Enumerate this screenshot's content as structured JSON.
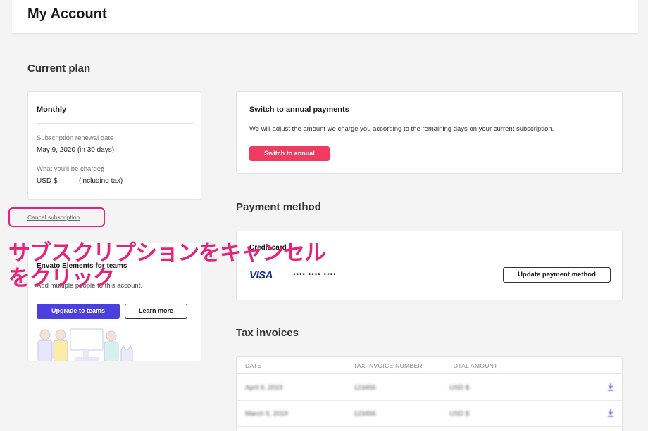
{
  "header": {
    "title": "My Account"
  },
  "current_plan": {
    "section_title": "Current plan",
    "plan_name": "Monthly",
    "renewal_label": "Subscription renewal date",
    "renewal_value": "May 9, 2020 (in 30 days)",
    "charge_label": "What you'll be charged",
    "charge_stray_char": "0",
    "charge_currency": "USD $",
    "charge_note": "(including tax)",
    "cancel_link": "Cancel subscription"
  },
  "teams": {
    "title": "Envato Elements for teams",
    "description": "Add multiple people to this account.",
    "upgrade_button": "Upgrade to teams",
    "learn_more_button": "Learn more"
  },
  "annual": {
    "title": "Switch to annual payments",
    "description": "We will adjust the amount we charge you according to the remaining days on your current subscription.",
    "button": "Switch to annual"
  },
  "payment": {
    "section_title": "Payment method",
    "card_label": "Credit card",
    "brand": "VISA",
    "masked_number": "•••• •••• ••••",
    "update_button": "Update payment method"
  },
  "tax": {
    "section_title": "Tax invoices",
    "columns": [
      "DATE",
      "TAX INVOICE NUMBER",
      "TOTAL AMOUNT"
    ],
    "rows": [
      {
        "date": "April 9, 2019",
        "number": "123456",
        "amount": "USD $"
      },
      {
        "date": "March 9, 2019",
        "number": "123456",
        "amount": "USD $"
      }
    ]
  },
  "annotation": {
    "line1": "サブスクリプションをキャンセル",
    "line2": "をクリック",
    "color": "#e6237a"
  },
  "colors": {
    "accent_red": "#f03a5f",
    "accent_purple": "#4a3fe0",
    "annotation_pink": "#e6237a"
  }
}
